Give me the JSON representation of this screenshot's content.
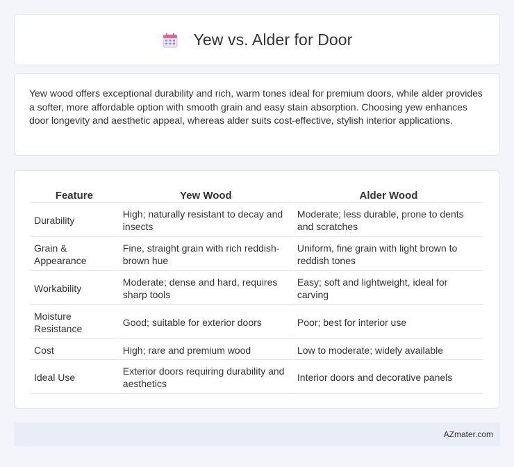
{
  "header": {
    "title": "Yew vs. Alder for Door",
    "icon": "calendar-icon"
  },
  "summary": {
    "text": "Yew wood offers exceptional durability and rich, warm tones ideal for premium doors, while alder provides a softer, more affordable option with smooth grain and easy stain absorption. Choosing yew enhances door longevity and aesthetic appeal, whereas alder suits cost-effective, stylish interior applications."
  },
  "table": {
    "headers": [
      "Feature",
      "Yew Wood",
      "Alder Wood"
    ],
    "rows": [
      [
        "Durability",
        "High; naturally resistant to decay and insects",
        "Moderate; less durable, prone to dents and scratches"
      ],
      [
        "Grain & Appearance",
        "Fine, straight grain with rich reddish-brown hue",
        "Uniform, fine grain with light brown to reddish tones"
      ],
      [
        "Workability",
        "Moderate; dense and hard, requires sharp tools",
        "Easy; soft and lightweight, ideal for carving"
      ],
      [
        "Moisture Resistance",
        "Good; suitable for exterior doors",
        "Poor; best for interior use"
      ],
      [
        "Cost",
        "High; rare and premium wood",
        "Low to moderate; widely available"
      ],
      [
        "Ideal Use",
        "Exterior doors requiring durability and aesthetics",
        "Interior doors and decorative panels"
      ]
    ]
  },
  "footer": {
    "brand": "AZmater.com"
  }
}
